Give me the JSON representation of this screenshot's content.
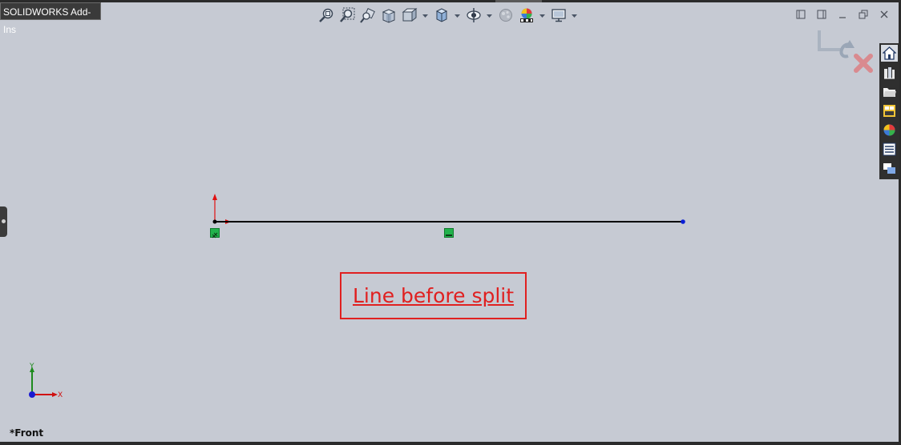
{
  "window": {
    "tab_title": "SOLIDWORKS Add-Ins"
  },
  "hud_toolbar": {
    "items": [
      {
        "icon": "zoom-to-fit-icon"
      },
      {
        "icon": "zoom-to-area-icon"
      },
      {
        "icon": "previous-view-icon"
      },
      {
        "icon": "section-view-icon"
      },
      {
        "icon": "view-orientation-icon",
        "has_dropdown": true
      },
      {
        "icon": "display-style-icon",
        "has_dropdown": true
      },
      {
        "icon": "hide-show-items-icon",
        "has_dropdown": true
      },
      {
        "icon": "edit-appearance-icon"
      },
      {
        "icon": "apply-scene-icon",
        "has_dropdown": true
      },
      {
        "icon": "view-settings-icon",
        "has_dropdown": true
      }
    ]
  },
  "window_controls": {
    "items": [
      {
        "icon": "tile-left-icon"
      },
      {
        "icon": "tile-right-icon"
      },
      {
        "icon": "minimize-icon"
      },
      {
        "icon": "restore-icon"
      },
      {
        "icon": "close-icon"
      }
    ]
  },
  "task_pane": {
    "items": [
      {
        "icon": "solidworks-resources-icon",
        "active": true
      },
      {
        "icon": "design-library-icon"
      },
      {
        "icon": "file-explorer-icon"
      },
      {
        "icon": "view-palette-icon"
      },
      {
        "icon": "appearances-scenes-icon"
      },
      {
        "icon": "custom-properties-icon"
      },
      {
        "icon": "solidworks-forum-icon"
      }
    ]
  },
  "sketch": {
    "relations": [
      "fixed-relation-icon",
      "horizontal-relation-icon"
    ]
  },
  "callout": {
    "text": "Line before split"
  },
  "triad": {
    "x_label": "X",
    "y_label": "Y"
  },
  "view": {
    "name": "*Front"
  },
  "colors": {
    "background": "#c6cad3",
    "line": "#000000",
    "endpoint": "#0a1fd6",
    "relation": "#22b24c",
    "callout": "#e02020"
  }
}
